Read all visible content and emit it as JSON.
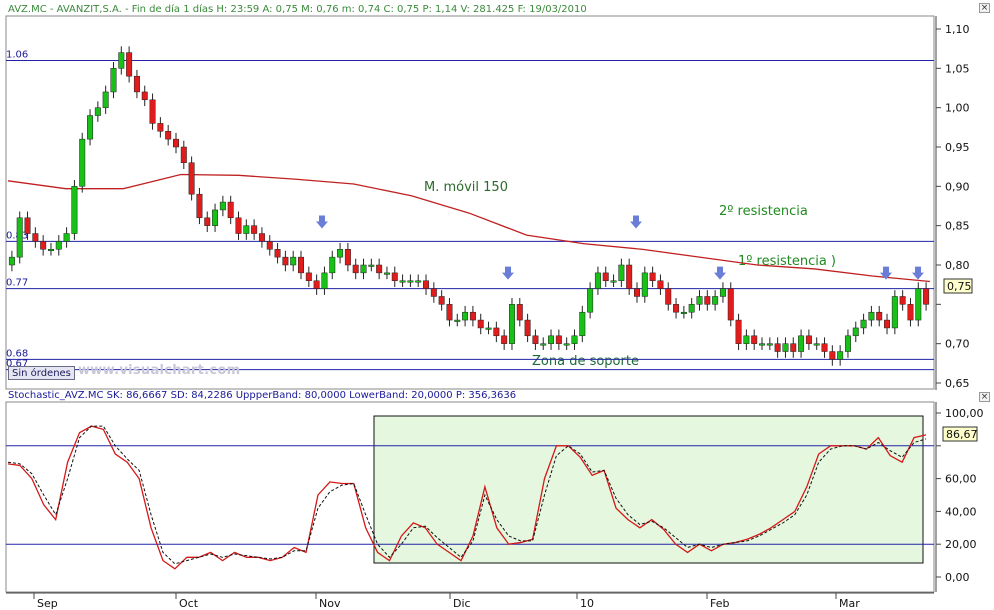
{
  "header": {
    "price_info": "AVZ.MC - AVANZIT,S.A. - Fin de día 1 días H: 23:59 A: 0,75 M: 0,76 m: 0,74 C: 0,75 P: 1,14 V: 281.425 F: 19/03/2010",
    "close_icon": "close-icon"
  },
  "price_panel": {
    "last_price_label": "0,75",
    "y_ticks": [
      "1,10",
      "1,05",
      "1,00",
      "0,95",
      "0,90",
      "0,85",
      "0,80",
      "0,75",
      "0,70",
      "0,65"
    ],
    "h_levels": [
      {
        "label": "1.06",
        "value": 1.06
      },
      {
        "label": "0.83",
        "value": 0.83
      },
      {
        "label": "0.77",
        "value": 0.77
      },
      {
        "label": "0.68",
        "value": 0.68
      },
      {
        "label": "0.67",
        "value": 0.667
      }
    ],
    "annotations": {
      "ma_label": "M. móvil 150",
      "resistance2": "2º resistencia",
      "resistance1": "1º resistencia )",
      "support": "Zona de soporte"
    },
    "orders_button": "Sin órdenes",
    "watermark": "www.visualchart.com"
  },
  "stoch_panel": {
    "header": "Stochastic_AVZ.MC SK: 86,6667 SD: 84,2286 UppperBand: 80,0000 LowerBand: 20,0000 P: 356,3636",
    "last_value_label": "86,67",
    "y_ticks": [
      "100,00",
      "80,00",
      "60,00",
      "40,00",
      "20,00",
      "0,00"
    ]
  },
  "x_axis": {
    "labels": [
      "Sep",
      "Oct",
      "Nov",
      "Dic",
      "10",
      "Feb",
      "Mar"
    ]
  },
  "chart_data": [
    {
      "type": "candlestick",
      "title": "AVZ.MC - AVANZIT,S.A.",
      "y_range": [
        0.65,
        1.11
      ],
      "x_labels": [
        "Sep",
        "Oct",
        "Nov",
        "Dic",
        "10",
        "Feb",
        "Mar"
      ],
      "closes": [
        0.81,
        0.86,
        0.84,
        0.83,
        0.82,
        0.82,
        0.83,
        0.84,
        0.9,
        0.96,
        0.99,
        1.0,
        1.02,
        1.05,
        1.07,
        1.04,
        1.02,
        1.01,
        0.98,
        0.97,
        0.96,
        0.95,
        0.93,
        0.89,
        0.86,
        0.85,
        0.87,
        0.88,
        0.86,
        0.84,
        0.85,
        0.84,
        0.83,
        0.82,
        0.81,
        0.8,
        0.81,
        0.79,
        0.78,
        0.77,
        0.79,
        0.81,
        0.82,
        0.8,
        0.79,
        0.8,
        0.8,
        0.79,
        0.79,
        0.78,
        0.78,
        0.78,
        0.78,
        0.77,
        0.76,
        0.75,
        0.73,
        0.73,
        0.74,
        0.73,
        0.72,
        0.72,
        0.71,
        0.7,
        0.75,
        0.73,
        0.71,
        0.7,
        0.7,
        0.71,
        0.7,
        0.7,
        0.71,
        0.74,
        0.77,
        0.79,
        0.78,
        0.78,
        0.8,
        0.77,
        0.76,
        0.79,
        0.78,
        0.77,
        0.75,
        0.74,
        0.74,
        0.75,
        0.76,
        0.75,
        0.76,
        0.77,
        0.73,
        0.7,
        0.71,
        0.7,
        0.7,
        0.7,
        0.69,
        0.7,
        0.69,
        0.71,
        0.7,
        0.7,
        0.69,
        0.68,
        0.69,
        0.71,
        0.72,
        0.73,
        0.74,
        0.73,
        0.72,
        0.76,
        0.75,
        0.73,
        0.77,
        0.75
      ],
      "moving_average_150": [
        0.907,
        0.897,
        0.897,
        0.915,
        0.914,
        0.909,
        0.903,
        0.888,
        0.866,
        0.838,
        0.827,
        0.82,
        0.81,
        0.8,
        0.795,
        0.786,
        0.779
      ],
      "levels": {
        "resistance_2": 0.83,
        "resistance_1": 0.77,
        "support_top": 0.68,
        "support_bottom": 0.667
      },
      "last": 0.75
    },
    {
      "type": "line",
      "title": "Stochastic_AVZ.MC",
      "y_range": [
        0,
        100
      ],
      "series": [
        {
          "name": "SK",
          "values": [
            69,
            68,
            60,
            44,
            35,
            70,
            88,
            92,
            90,
            75,
            70,
            60,
            30,
            10,
            5,
            12,
            12,
            15,
            10,
            15,
            12,
            12,
            10,
            12,
            18,
            15,
            50,
            58,
            57,
            57,
            30,
            15,
            10,
            25,
            33,
            30,
            20,
            15,
            10,
            25,
            55,
            30,
            20,
            21,
            23,
            60,
            80,
            80,
            73,
            62,
            65,
            42,
            35,
            30,
            35,
            29,
            20,
            15,
            20,
            16,
            20,
            21,
            23,
            26,
            30,
            35,
            40,
            55,
            75,
            80,
            80,
            80,
            78,
            85,
            74,
            70,
            85,
            86.67
          ]
        },
        {
          "name": "SD",
          "values": [
            70,
            69,
            63,
            50,
            38,
            60,
            85,
            92,
            92,
            80,
            72,
            65,
            38,
            15,
            8,
            10,
            12,
            14,
            12,
            14,
            13,
            12,
            11,
            12,
            16,
            16,
            42,
            52,
            56,
            57,
            38,
            20,
            12,
            20,
            30,
            31,
            24,
            18,
            12,
            22,
            50,
            35,
            25,
            22,
            22,
            50,
            74,
            80,
            75,
            64,
            65,
            48,
            38,
            32,
            34,
            30,
            24,
            18,
            20,
            18,
            20,
            21,
            22,
            25,
            29,
            33,
            38,
            50,
            70,
            78,
            80,
            80,
            78,
            82,
            77,
            73,
            82,
            84.23
          ]
        }
      ],
      "bands": {
        "upper": 80,
        "lower": 20
      },
      "last": 86.67
    }
  ]
}
